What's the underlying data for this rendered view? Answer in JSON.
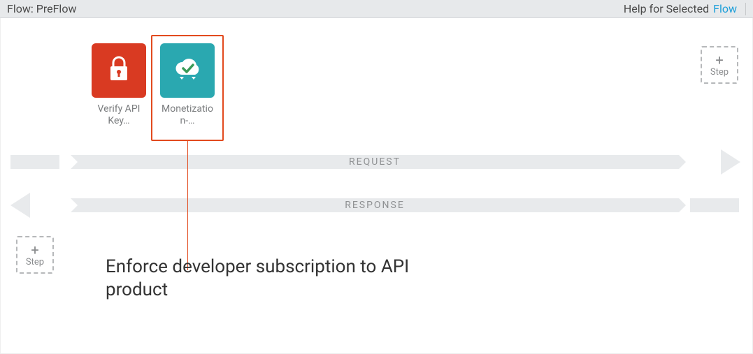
{
  "header": {
    "title": "Flow: PreFlow",
    "help_label": "Help for Selected",
    "flow_link": "Flow"
  },
  "policies": [
    {
      "label": "Verify API Key…",
      "icon": "lock-icon",
      "tile": "red"
    },
    {
      "label": "Monetization-…",
      "icon": "cloud-check-icon",
      "tile": "teal"
    }
  ],
  "flow": {
    "request_label": "REQUEST",
    "response_label": "RESPONSE"
  },
  "add_step_label": "Step",
  "callout": "Enforce developer subscription to API product"
}
